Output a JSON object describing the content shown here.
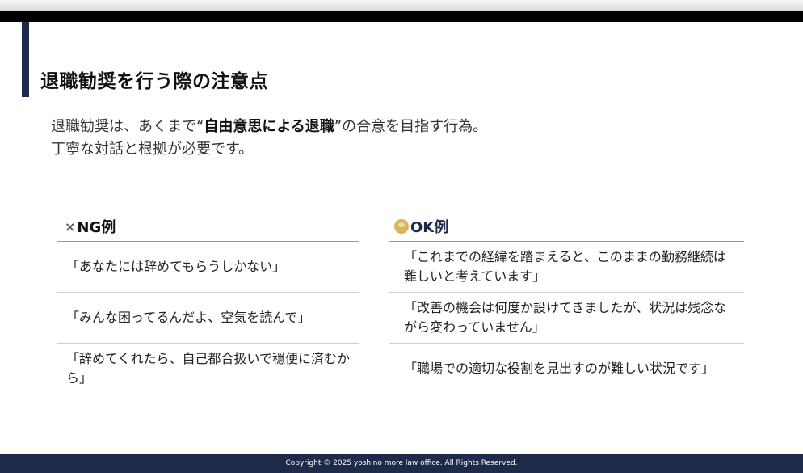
{
  "slide": {
    "title": "退職勧奨を行う際の注意点",
    "intro": {
      "prefix": "退職勧奨は、あくまで“",
      "bold": "自由意思による退職",
      "suffix": "”の合意を目指す行為。",
      "line2": "丁寧な対話と根拠が必要です。"
    }
  },
  "ng": {
    "icon": "×",
    "heading": "NG例",
    "items": [
      "「あなたには辞めてもらうしかない」",
      "「みんな困ってるんだよ、空気を読んで」",
      "「辞めてくれたら、自己都合扱いで穏便に済むから」"
    ]
  },
  "ok": {
    "icon_name": "person-icon",
    "heading": "OK例",
    "items": [
      "「これまでの経緯を踏まえると、このままの勤務継続は難しいと考えています」",
      "「改善の機会は何度か設けてきましたが、状況は残念ながら変わっていません」",
      "「職場での適切な役割を見出すのが難しい状況です」"
    ]
  },
  "footer": {
    "copyright": "Copyright © 2025 yoshino more law office. All Rights Reserved."
  },
  "colors": {
    "accent": "#1e2a4a",
    "top_bar": "#000000"
  }
}
